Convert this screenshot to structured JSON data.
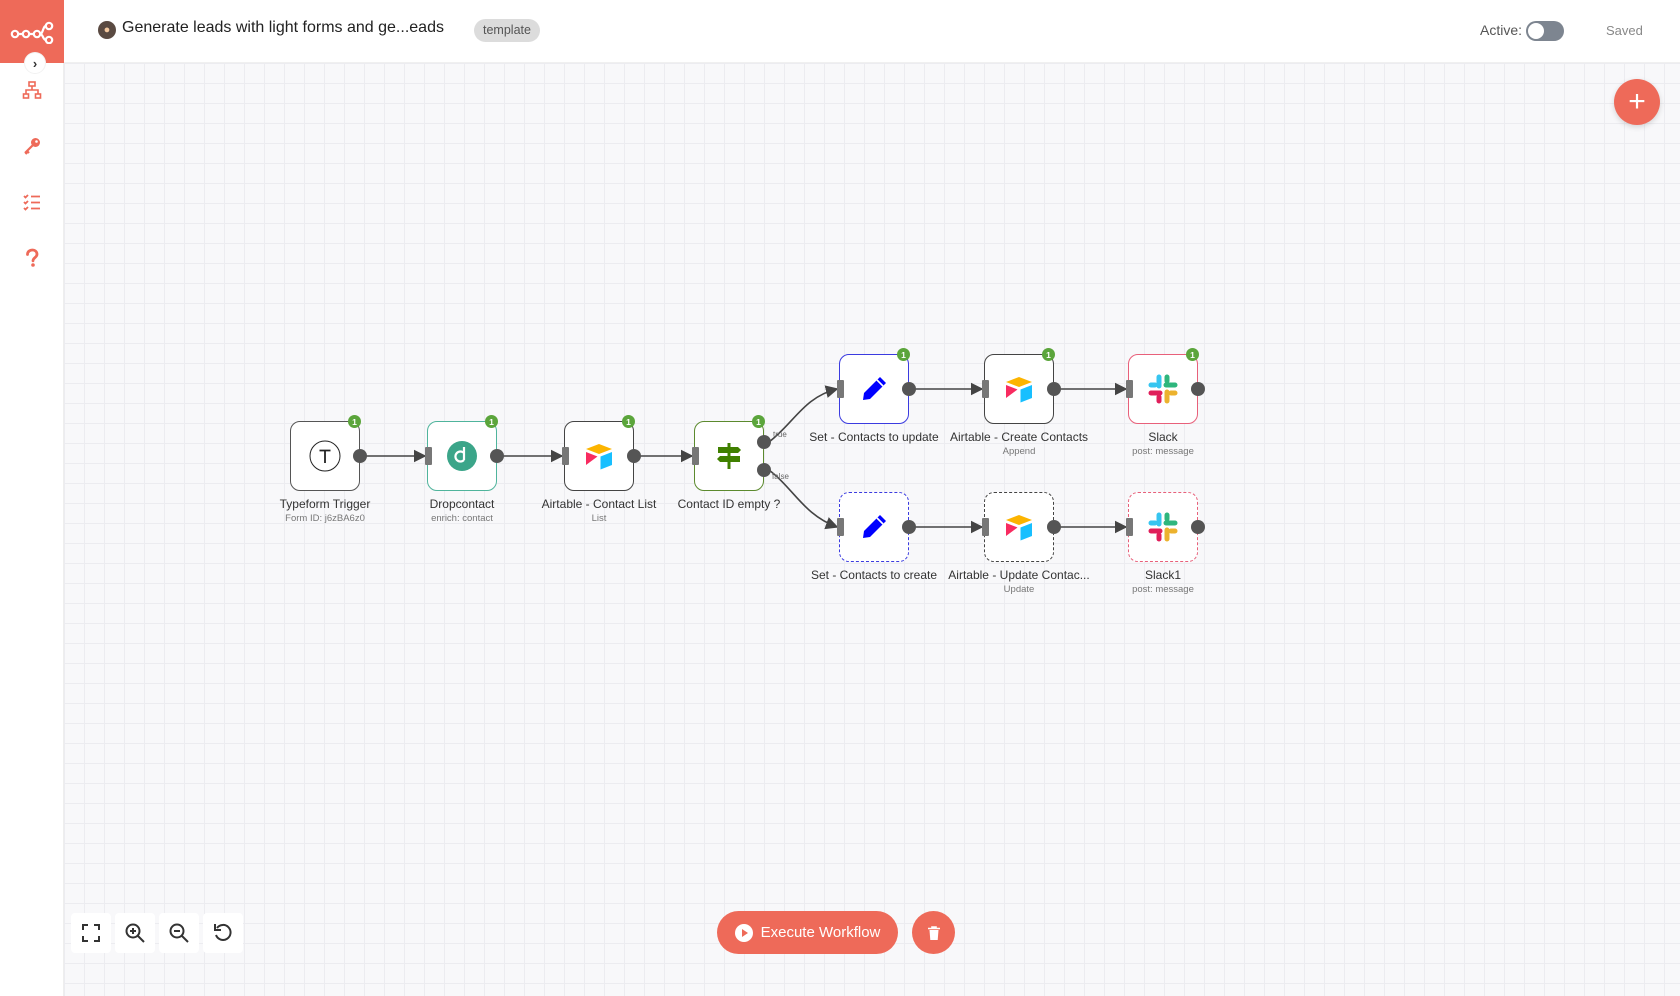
{
  "header": {
    "workflow_title": "Generate leads with light forms and ge...eads",
    "tag": "template",
    "active_label": "Active:",
    "active_state": false,
    "save_status": "Saved"
  },
  "colors": {
    "accent": "#ee6a59",
    "success_badge": "#5ba53b",
    "canvas_bg": "#f8f8fa"
  },
  "sidebar": {
    "items": [
      {
        "icon": "network-icon",
        "label": ""
      },
      {
        "icon": "key-icon",
        "label": ""
      },
      {
        "icon": "list-icon",
        "label": ""
      },
      {
        "icon": "help-icon",
        "label": ""
      }
    ]
  },
  "nodes": [
    {
      "title": "Typeform Trigger",
      "subtitle": "Form ID: j6zBA6z0",
      "badge": "1"
    },
    {
      "title": "Dropcontact",
      "subtitle": "enrich: contact",
      "badge": "1"
    },
    {
      "title": "Airtable - Contact List",
      "subtitle": "List",
      "badge": "1"
    },
    {
      "title": "Contact ID empty ?",
      "subtitle": "",
      "badge": "1"
    },
    {
      "title": "Set - Contacts to update",
      "subtitle": "",
      "badge": "1"
    },
    {
      "title": "Airtable - Create Contacts",
      "subtitle": "Append",
      "badge": "1"
    },
    {
      "title": "Slack",
      "subtitle": "post: message",
      "badge": "1"
    },
    {
      "title": "Set - Contacts to create",
      "subtitle": ""
    },
    {
      "title": "Airtable - Update Contac...",
      "subtitle": "Update"
    },
    {
      "title": "Slack1",
      "subtitle": "post: message"
    }
  ],
  "branches": {
    "true_label": "true",
    "false_label": "false"
  },
  "footer": {
    "execute_label": "Execute Workflow"
  }
}
